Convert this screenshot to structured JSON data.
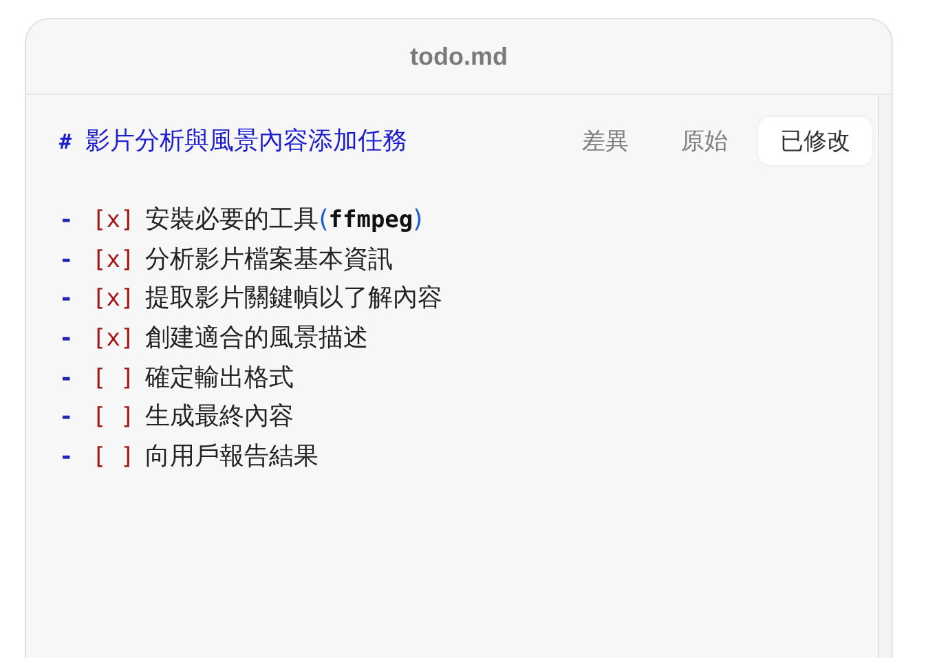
{
  "window": {
    "title": "todo.md"
  },
  "heading": {
    "marker": "#",
    "text": "影片分析與風景內容添加任務"
  },
  "tabs": [
    {
      "label": "差異",
      "selected": false
    },
    {
      "label": "原始",
      "selected": false
    },
    {
      "label": "已修改",
      "selected": true
    }
  ],
  "tasks": [
    {
      "bullet": "-",
      "box": "[x]",
      "segments": [
        {
          "kind": "plain",
          "text": "安裝必要的工具"
        },
        {
          "kind": "paren",
          "text": "("
        },
        {
          "kind": "code",
          "text": "ffmpeg"
        },
        {
          "kind": "paren",
          "text": ")"
        }
      ]
    },
    {
      "bullet": "-",
      "box": "[x]",
      "segments": [
        {
          "kind": "plain",
          "text": "分析影片檔案基本資訊"
        }
      ]
    },
    {
      "bullet": "-",
      "box": "[x]",
      "segments": [
        {
          "kind": "plain",
          "text": "提取影片關鍵幀以了解內容"
        }
      ]
    },
    {
      "bullet": "-",
      "box": "[x]",
      "segments": [
        {
          "kind": "plain",
          "text": "創建適合的風景描述"
        }
      ]
    },
    {
      "bullet": "-",
      "box": "[ ]",
      "segments": [
        {
          "kind": "plain",
          "text": "確定輸出格式"
        }
      ]
    },
    {
      "bullet": "-",
      "box": "[ ]",
      "segments": [
        {
          "kind": "plain",
          "text": "生成最終內容"
        }
      ]
    },
    {
      "bullet": "-",
      "box": "[ ]",
      "segments": [
        {
          "kind": "plain",
          "text": "向用戶報告結果"
        }
      ]
    }
  ]
}
